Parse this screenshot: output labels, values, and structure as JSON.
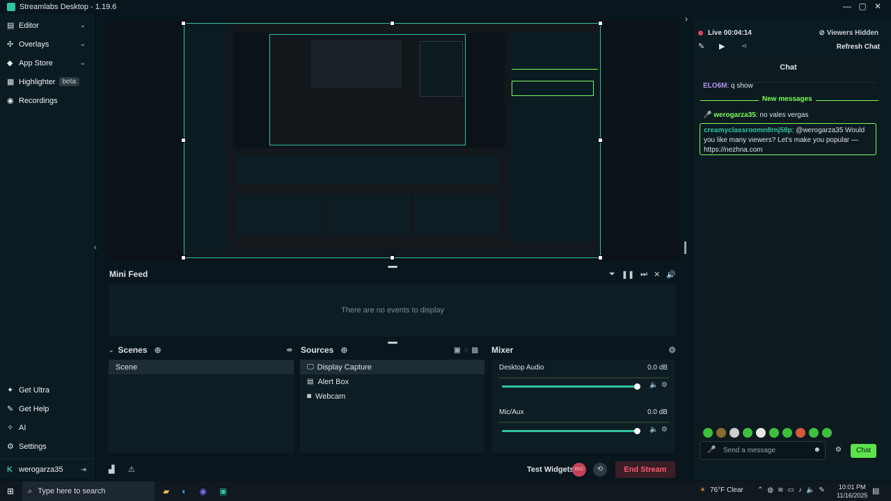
{
  "app": {
    "title": "Streamlabs Desktop - 1.19.6"
  },
  "window_controls": {
    "minimize": "—",
    "maximize": "▢",
    "close": "✕"
  },
  "sidebar": {
    "top_items": [
      {
        "label": "Editor",
        "icon": "editor-icon"
      },
      {
        "label": "Overlays",
        "icon": "overlays-icon"
      },
      {
        "label": "App Store",
        "icon": "app-store-icon"
      },
      {
        "label": "Highlighter",
        "icon": "highlighter-icon",
        "badge": "beta"
      },
      {
        "label": "Recordings",
        "icon": "recordings-icon"
      }
    ],
    "bottom_items": [
      {
        "label": "Get Ultra",
        "icon": "ultra-icon"
      },
      {
        "label": "Get Help",
        "icon": "help-icon"
      },
      {
        "label": "AI",
        "icon": "ai-icon"
      },
      {
        "label": "Settings",
        "icon": "gear-icon"
      }
    ],
    "user": "werogarza35"
  },
  "minifeed": {
    "title": "Mini Feed",
    "empty": "There are no events to display"
  },
  "scenes": {
    "title": "Scenes",
    "items": [
      "Scene"
    ]
  },
  "sources": {
    "title": "Sources",
    "items": [
      "Display Capture",
      "Alert Box",
      "Webcam"
    ]
  },
  "mixer": {
    "title": "Mixer",
    "channels": [
      {
        "name": "Desktop Audio",
        "level": "0.0 dB",
        "volume": 1.0
      },
      {
        "name": "Mic/Aux",
        "level": "0.0 dB",
        "volume": 1.0
      }
    ]
  },
  "bottombar": {
    "test_widgets": "Test Widgets",
    "rec": "REC",
    "end_stream": "End Stream"
  },
  "chat": {
    "live_label": "Live",
    "live_time": "00:04:14",
    "viewers": "Viewers Hidden",
    "refresh": "Refresh Chat",
    "title": "Chat",
    "messages": [
      {
        "user": "ELO6M",
        "text": ": q show"
      },
      {
        "divider": "New messages"
      },
      {
        "user": "werogarza35",
        "text": ": no vales vergas"
      },
      {
        "user": "creamyclassroomn8rnj58p",
        "text": ": @werogarza35 Would you like many viewers? Let's make you popular — https://nezhna.com"
      }
    ],
    "input_placeholder": "Send a message",
    "send": "Chat"
  },
  "taskbar": {
    "search_placeholder": "Type here to search",
    "weather": "76°F  Clear",
    "time": "10:01 PM",
    "date": "11/16/2025"
  },
  "colors": {
    "accent": "#31c3a2",
    "live": "#e0455c",
    "chat_green": "#7bff5a"
  }
}
